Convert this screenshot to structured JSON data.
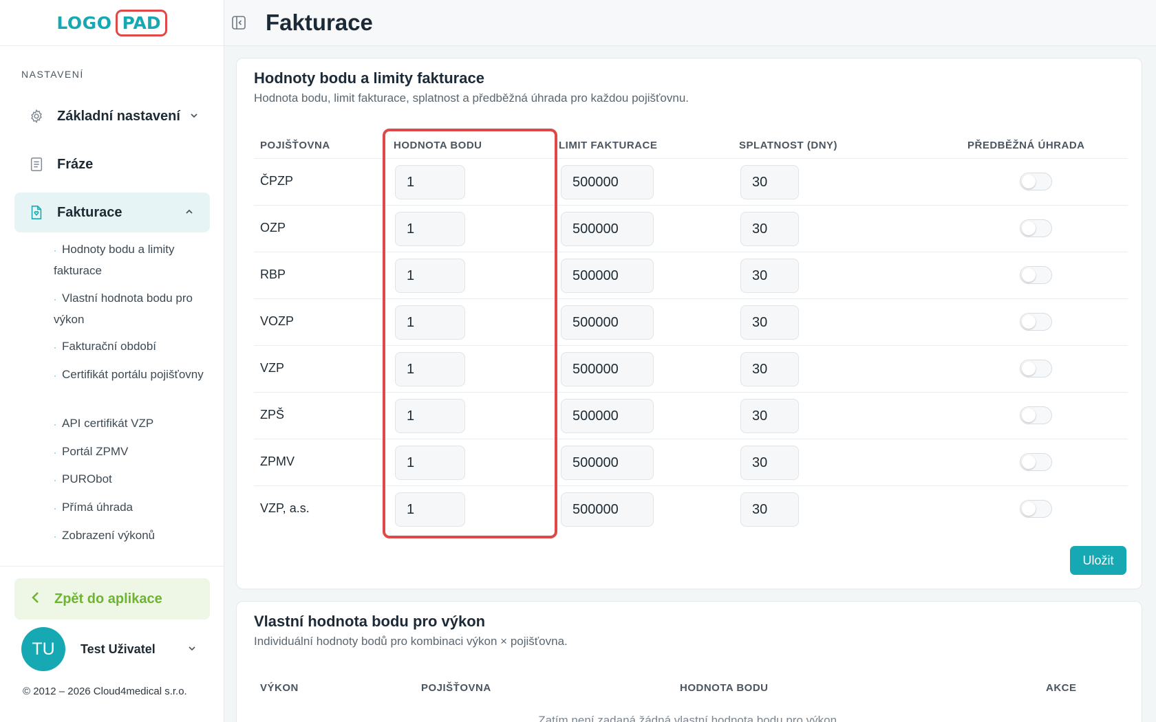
{
  "logo": {
    "left": "LOGO",
    "right": "PAD"
  },
  "sidebar": {
    "section_title": "NASTAVENÍ",
    "items": [
      {
        "label": "Základní nastavení",
        "icon": "gear-icon"
      },
      {
        "label": "Fráze",
        "icon": "document-icon"
      },
      {
        "label": "Fakturace",
        "icon": "invoice-icon"
      }
    ],
    "sub_items": [
      "Hodnoty bodu a limity fakturace",
      "Vlastní hodnota bodu pro výkon",
      "Fakturační období",
      "Certifikát portálu pojišťovny",
      "API certifikát VZP",
      "Portál ZPMV",
      "PURObot",
      "Přímá úhrada",
      "Zobrazení výkonů"
    ],
    "back_label": "Zpět do aplikace",
    "user": {
      "initials": "TU",
      "name": "Test Uživatel"
    },
    "copyright": "© 2012 – 2026 Cloud4medical s.r.o."
  },
  "header": {
    "title": "Fakturace"
  },
  "card1": {
    "title": "Hodnoty bodu a limity fakturace",
    "subtitle": "Hodnota bodu, limit fakturace, splatnost a předběžná úhrada pro každou pojišťovnu.",
    "columns": [
      "POJIŠŤOVNA",
      "HODNOTA BODU",
      "LIMIT FAKTURACE",
      "SPLATNOST (DNY)",
      "PŘEDBĚŽNÁ ÚHRADA"
    ],
    "rows": [
      {
        "name": "ČPZP",
        "hodnota": "1",
        "limit": "500000",
        "splatnost": "30",
        "prepaid": false
      },
      {
        "name": "OZP",
        "hodnota": "1",
        "limit": "500000",
        "splatnost": "30",
        "prepaid": false
      },
      {
        "name": "RBP",
        "hodnota": "1",
        "limit": "500000",
        "splatnost": "30",
        "prepaid": false
      },
      {
        "name": "VOZP",
        "hodnota": "1",
        "limit": "500000",
        "splatnost": "30",
        "prepaid": false
      },
      {
        "name": "VZP",
        "hodnota": "1",
        "limit": "500000",
        "splatnost": "30",
        "prepaid": false
      },
      {
        "name": "ZPŠ",
        "hodnota": "1",
        "limit": "500000",
        "splatnost": "30",
        "prepaid": false
      },
      {
        "name": "ZPMV",
        "hodnota": "1",
        "limit": "500000",
        "splatnost": "30",
        "prepaid": false
      },
      {
        "name": "VZP, a.s.",
        "hodnota": "1",
        "limit": "500000",
        "splatnost": "30",
        "prepaid": false
      }
    ],
    "save_label": "Uložit"
  },
  "card2": {
    "title": "Vlastní hodnota bodu pro výkon",
    "subtitle": "Individuální hodnoty bodů pro kombinaci výkon × pojišťovna.",
    "columns": [
      "VÝKON",
      "POJIŠŤOVNA",
      "HODNOTA BODU",
      "AKCE"
    ],
    "empty_note": "Zatím není zadaná žádná vlastní hodnota bodu pro výkon."
  },
  "colors": {
    "accent": "#16a9b4",
    "highlight": "#e04848",
    "back_green": "#6db431"
  }
}
